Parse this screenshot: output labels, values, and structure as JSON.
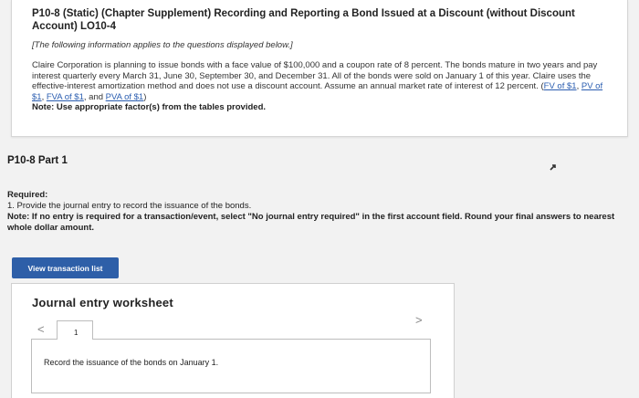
{
  "problem": {
    "title": "P10-8 (Static) (Chapter Supplement) Recording and Reporting a Bond Issued at a Discount (without Discount Account) LO10-4",
    "info_note": "[The following information applies to the questions displayed below.]",
    "body_text": "Claire Corporation is planning to issue bonds with a face value of $100,000 and a coupon rate of 8 percent. The bonds mature in two years and pay interest quarterly every March 31, June 30, September 30, and December 31. All of the bonds were sold on January 1 of this year. Claire uses the effective-interest amortization method and does not use a discount account. Assume an annual market rate of interest of 12 percent.",
    "links": {
      "open_paren": "(",
      "fv": "FV of $1",
      "pv": "PV of $1",
      "fva": "FVA of $1",
      "and": "and",
      "pva": "PVA of $1",
      "close_paren": ")"
    },
    "factor_note": "Note: Use appropriate factor(s) from the tables provided."
  },
  "part": {
    "label": "P10-8 Part 1"
  },
  "required": {
    "heading": "Required:",
    "item": "1. Provide the journal entry to record the issuance of the bonds.",
    "note": "Note: If no entry is required for a transaction/event, select \"No journal entry required\" in the first account field. Round your final answers to nearest whole dollar amount."
  },
  "buttons": {
    "view_transaction_list": "View transaction list"
  },
  "worksheet": {
    "title": "Journal entry worksheet",
    "page_number": "1",
    "prev": "<",
    "next": ">",
    "record_text": "Record the issuance of the bonds on January 1."
  }
}
